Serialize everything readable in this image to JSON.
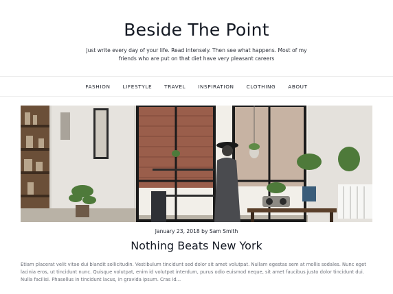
{
  "site": {
    "title": "Beside The Point",
    "tagline": "Just write every day of your life. Read intensely. Then see what happens. Most of my friends who are put on that diet have very pleasant careers"
  },
  "nav": {
    "items": [
      {
        "label": "FASHION"
      },
      {
        "label": "LIFESTYLE"
      },
      {
        "label": "TRAVEL"
      },
      {
        "label": "INSPIRATION"
      },
      {
        "label": "CLOTHING"
      },
      {
        "label": "ABOUT"
      }
    ]
  },
  "post": {
    "meta": "January 23, 2018 by Sam Smith",
    "title": "Nothing Beats New York",
    "excerpt": "Etiam placerat velit vitae dui blandit sollicitudin. Vestibulum tincidunt sed dolor sit amet volutpat. Nullam egestas sem at mollis sodales. Nunc eget lacinia eros, ut tincidunt nunc. Quisque volutpat, enim id volutpat interdum, purus odio euismod neque, sit amet faucibus justo dolor tincidunt dui. Nulla facilisi. Phasellus in tincidunt lacus, in gravida ipsum. Cras id..."
  }
}
